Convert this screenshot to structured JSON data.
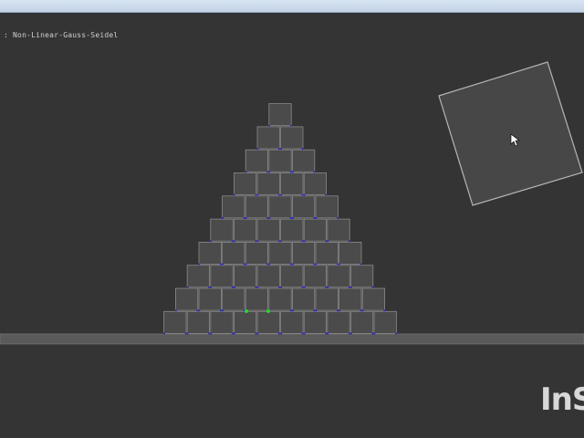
{
  "window": {
    "title": ""
  },
  "overlay": {
    "solver_text": ": Non-Linear-Gauss-Seidel"
  },
  "scene": {
    "pyramid_rows": 10,
    "box_color": "#4b4b4b",
    "box_edge_color": "#8a8a8a",
    "ground_color": "#5a5a5a",
    "contact_point_color": "#2f2fb0",
    "highlight_contact_color": "#22dd22",
    "free_box_color": "#474747"
  },
  "watermark": {
    "text": "InS"
  }
}
